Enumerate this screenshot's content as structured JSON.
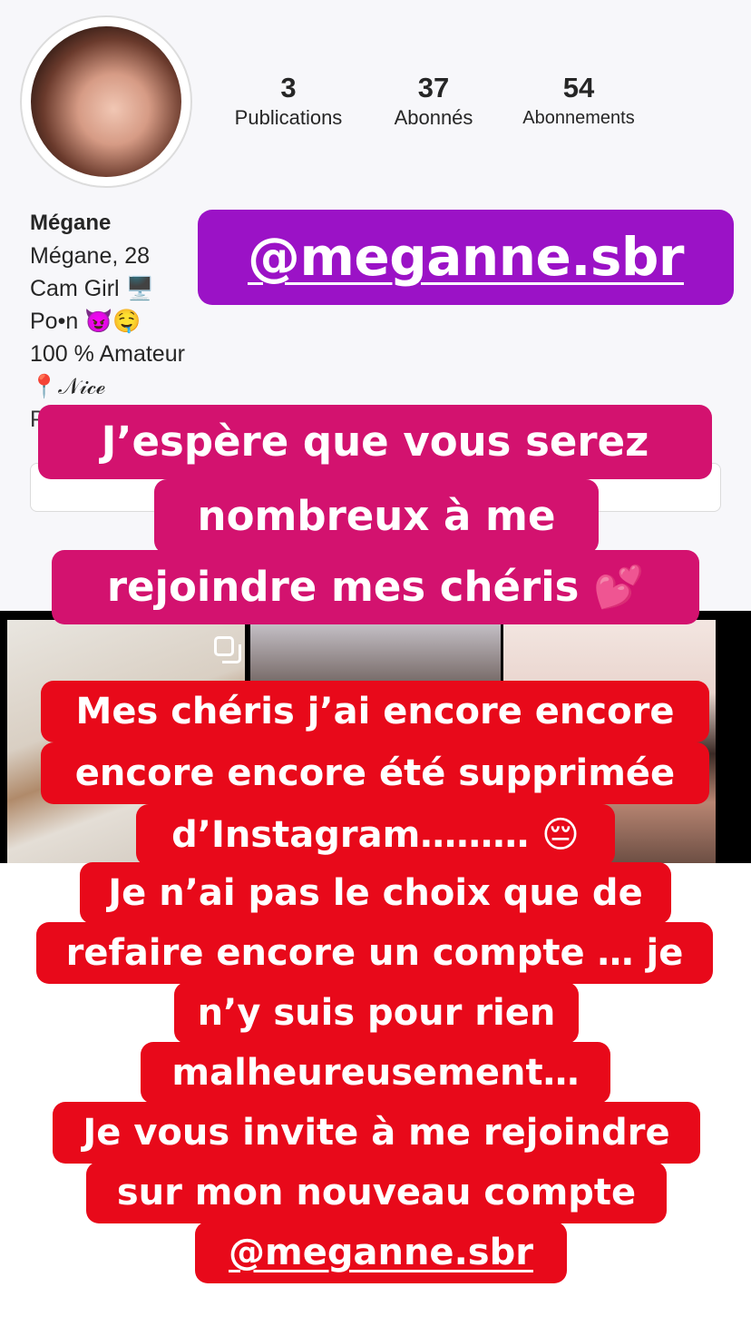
{
  "profile": {
    "stats": [
      {
        "value": "3",
        "label": "Publications"
      },
      {
        "value": "37",
        "label": "Abonnés"
      },
      {
        "value": "54",
        "label": "Abonnements"
      }
    ],
    "bio": {
      "name": "Mégane",
      "lines": [
        "Mégane, 28",
        "Cam Girl 🖥️",
        "Po•n 😈🤤",
        "100 % Amateur",
        "📍𝒩𝒾𝒸ℯ",
        "P"
      ]
    }
  },
  "overlay": {
    "handle": "@meganne.sbr",
    "pink_lines": [
      "J’espère que vous serez",
      "nombreux à me",
      "rejoindre mes chéris 💕"
    ],
    "red_lines": [
      "Mes chéris j’ai encore encore",
      "encore encore été supprimée",
      "d’Instagram……… 😔",
      "Je n’ai pas le choix que de",
      "refaire encore un compte … je",
      "n’y suis pour rien",
      "malheureusement…",
      "Je vous invite à me rejoindre",
      "sur mon nouveau compte",
      "@meganne.sbr"
    ]
  },
  "colors": {
    "handle_bg": "#9b12c6",
    "pink_bg": "#d3126f",
    "red_bg": "#e8091a"
  }
}
